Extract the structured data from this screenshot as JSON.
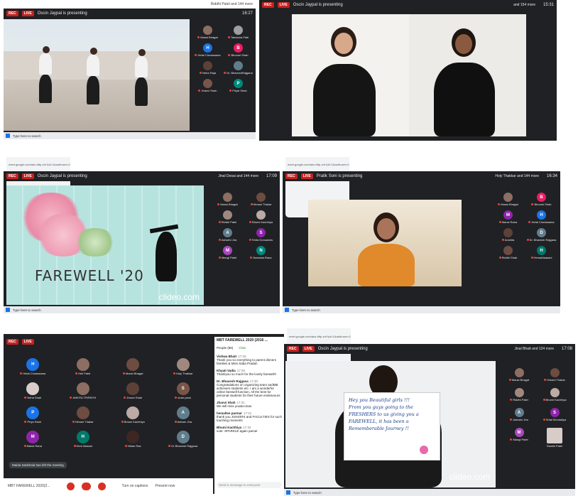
{
  "colors": {
    "meet_bg": "#202124",
    "rec": "#c5221f",
    "accent": "#1a73e8"
  },
  "taskbar_search": "Type here to search",
  "p1": {
    "rec": "REC",
    "live": "LIVE",
    "presenting": "Oscin Jaypal is presenting",
    "others": "Riddhi Patel and 144 more",
    "clock": "16:27",
    "participants": [
      "Mansi Bhagat",
      "Tamanna Patil",
      "Hetal Chudasama",
      "Bhoomi Shah",
      "Neha Raja",
      "Dr. BhaveshRajgana",
      "Jhanvi Shah",
      "Priyal Shah"
    ]
  },
  "p2": {
    "rec": "REC",
    "live": "LIVE",
    "presenting": "Oscin Jaypal is presenting",
    "others": "and 154 more",
    "clock": "15:31"
  },
  "p3": {
    "rec": "REC",
    "live": "LIVE",
    "presenting": "Oscin Jaypal is presenting",
    "url": "meet.google.com/ako-bftp-zhr?pli=1&authuser=0",
    "others": "Jinal Desai and 144 more",
    "clock": "17:09",
    "farewell": "FAREWELL '20",
    "watermark": "clideo.com",
    "participants": [
      "Mansi Bhagat",
      "Himani Thakar",
      "Riddhi Patel",
      "Bhumi Kachhiya",
      "Ashwini Jha",
      "Shita Gonsalves",
      "Mangi Patel",
      "Namrata Rana"
    ]
  },
  "p4": {
    "rec": "REC",
    "live": "LIVE",
    "presenting": "Pratik Soni is presenting",
    "url": "meet.google.com/ako-bftp-zhr?pli=1&authuser=0",
    "others": "Holy Thakkar and 144 more",
    "clock": "16:34",
    "participants": [
      "Mansi Bhagat",
      "Bhoomi Shah",
      "Mansi Rana",
      "Hetal Chudasama",
      "Anshita",
      "Dr. Bhavesh Rajgana",
      "Riddhi Shah",
      "HemaMaasani"
    ]
  },
  "p5": {
    "rec": "REC",
    "live": "LIVE",
    "meeting_name": "MBT FAREWELL 2020(2...",
    "left_notice": "Maida Sankhala has left the meeting",
    "turn_on_captions": "Turn on captions",
    "present_now": "Present now",
    "people_label": "People (86)",
    "chat_label": "Chat",
    "chat_title": "MBT FAREWELL 2020 (2016 ...",
    "send_placeholder": "Send a message to everyone",
    "participants": [
      "Hetal Chudasama",
      "Heli Patel",
      "Mansi Bhagat",
      "Holy Thakkar",
      "Neha Shah",
      "ANKITA TRIPATHI",
      "Jhanvi Shah",
      "shah parul",
      "Priya Rami",
      "Himani Thakar",
      "Bhumi Kachhiya",
      "Ashwin Jha",
      "Mansi Rana",
      "Hem Masani",
      "Nikan Ras",
      "Dr Bhavesh Rajgana"
    ],
    "chat": [
      {
        "who": "Vishwa Bhatt",
        "time": "17:29",
        "text": "Thank you so everything to parent dinners families & Miss Saba Pradan"
      },
      {
        "who": "Khyati Vadia",
        "time": "17:30",
        "text": "Thankyou so much for the lovely farewell!!"
      },
      {
        "who": "Dr. Bhavesh Rajgana",
        "time": "17:30",
        "text": "Congratulations on organizing team andMB achievers students etc. I am a wonderful online farewell function, All the best for personal students for their future endeavours"
      },
      {
        "who": "Jhanvi Shah",
        "time": "17:31",
        "text": "We will miss you&ccman"
      },
      {
        "who": "hemaltee parmar",
        "time": "17:31",
        "text": "thank you JUNIORS and FACULTIES for such touching moments"
      },
      {
        "who": "Bhumi Kachhiya",
        "time": "17:32",
        "text": "vote: SPARKLE again parva!"
      }
    ]
  },
  "p6": {
    "rec": "REC",
    "live": "LIVE",
    "presenting": "Oscin Jaypal is presenting",
    "url": "meet.google.com/ako-bftp-zhr?pli=1&authuser=0",
    "others": "Jinal Bhatt and 124 more",
    "clock": "17:08",
    "watermark": "clideo.com",
    "card_lines": [
      "Hey you Beautiful girls !!!",
      "From you guys going to the",
      "FRESHERS to us giving you a",
      "FAREWELL, it has been a",
      "Rememberable Journey !!"
    ],
    "participants": [
      "Mausi Bhagat",
      "Himani Thakar",
      "Riddhi Patel",
      "Bhumi Kachhiya",
      "Ashwini Jha",
      "Srital Mondaliya",
      "Mangi Patel",
      "Swathi Patel"
    ]
  }
}
